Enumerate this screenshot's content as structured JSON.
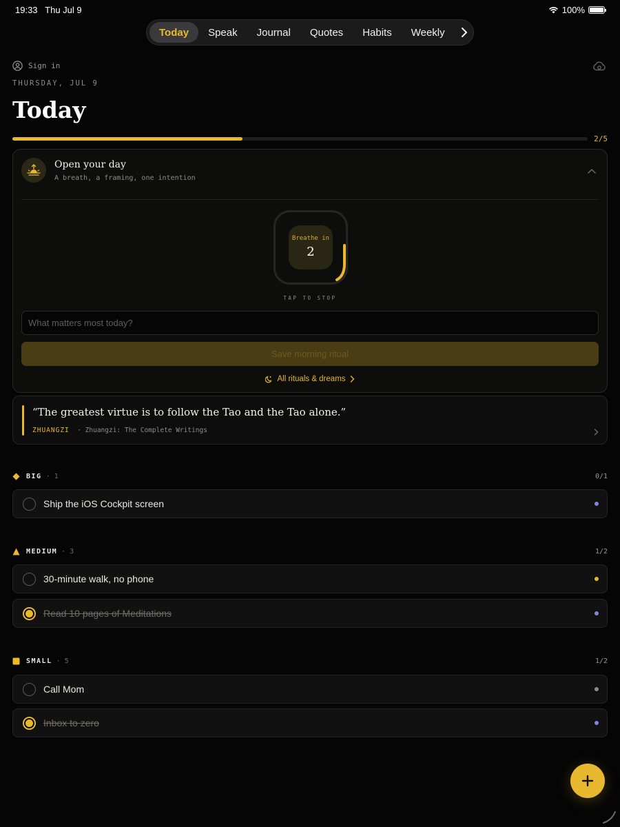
{
  "status": {
    "time": "19:33",
    "date": "Thu Jul 9",
    "battery": "100%"
  },
  "tabs": [
    {
      "label": "Today",
      "active": true
    },
    {
      "label": "Speak"
    },
    {
      "label": "Journal"
    },
    {
      "label": "Quotes"
    },
    {
      "label": "Habits"
    },
    {
      "label": "Weekly"
    }
  ],
  "header": {
    "signin_label": "Sign in",
    "date_line": "THURSDAY, JUL 9",
    "title": "Today",
    "progress_label": "2/5",
    "progress_fraction": 0.4
  },
  "ritual": {
    "title": "Open your day",
    "subtitle": "A breath, a framing, one intention",
    "breath_label": "Breathe in",
    "breath_count": "2",
    "tap_label": "TAP TO STOP",
    "intention_placeholder": "What matters most today?",
    "save_label": "Save morning ritual",
    "link_label": "All rituals & dreams"
  },
  "quote": {
    "text": "“The greatest virtue is to follow the Tao and the Tao alone.”",
    "author": "ZHUANGZI",
    "source": "· Zhuangzi: The Complete Writings"
  },
  "sections": {
    "big": {
      "name": "BIG",
      "count": "· 1",
      "ratio": "0/1"
    },
    "medium": {
      "name": "MEDIUM",
      "count": "· 3",
      "ratio": "1/2"
    },
    "small": {
      "name": "SMALL",
      "count": "· 5",
      "ratio": "1/2"
    }
  },
  "tasks": {
    "big": [
      {
        "title": "Ship the iOS Cockpit screen",
        "done": false,
        "dot_color": "#7f86e0"
      }
    ],
    "medium": [
      {
        "title": "30-minute walk, no phone",
        "done": false,
        "dot_color": "#e8b92e"
      },
      {
        "title": "Read 10 pages of Meditations",
        "done": true,
        "dot_color": "#7f86e0"
      }
    ],
    "small": [
      {
        "title": "Call Mom",
        "done": false,
        "dot_color": "#8e8e8e"
      },
      {
        "title": "Inbox to zero",
        "done": true,
        "dot_color": "#7f86e0"
      }
    ]
  },
  "colors": {
    "accent": "#e8b92e",
    "background": "#050505"
  },
  "icons": [
    "wifi-icon",
    "battery-icon",
    "chevron-right-icon",
    "user-circle-icon",
    "cloud-sync-icon",
    "sunrise-icon",
    "chevron-up-icon",
    "moon-icon",
    "diamond-icon",
    "triangle-icon",
    "square-icon",
    "plus-icon"
  ]
}
